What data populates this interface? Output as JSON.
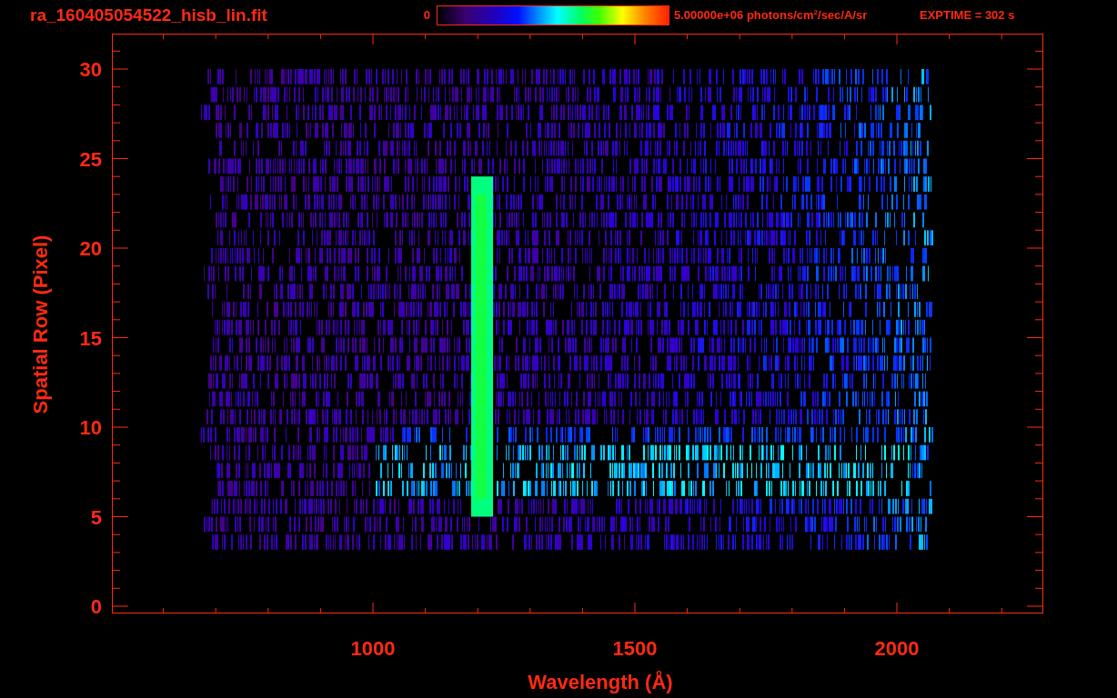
{
  "header": {
    "filename": "ra_160405054522_hisb_lin.fit",
    "colorbar": {
      "min_label": "0",
      "max_label": "5.00000e+06 photons/cm$^{2}$/sec/A/sr"
    },
    "exposure": "EXPTIME = 302 s"
  },
  "plot": {
    "xlabel": "Wavelength (Å)",
    "ylabel": "Spatial Row (Pixel)",
    "xticks": [
      "1000",
      "1500",
      "2000"
    ],
    "yticks": [
      "30",
      "25",
      "20",
      "15",
      "10",
      "5",
      "0"
    ]
  }
}
